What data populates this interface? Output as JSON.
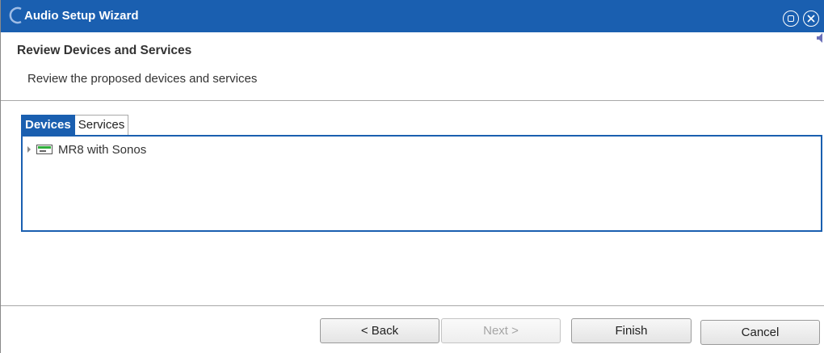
{
  "window": {
    "title": "Audio Setup Wizard",
    "accent_color": "#1a5fb0",
    "icons": [
      "app-logo-icon",
      "restore-icon",
      "close-icon",
      "speaker-icon"
    ]
  },
  "header": {
    "title": "Review Devices and Services",
    "subtitle": "Review the proposed devices and services"
  },
  "tabs": [
    {
      "label": "Devices",
      "selected": true
    },
    {
      "label": "Services",
      "selected": false
    }
  ],
  "devices_tree": [
    {
      "label": "MR8 with Sonos",
      "icon": "device-icon",
      "expanded": false
    }
  ],
  "footer": {
    "back_label": "< Back",
    "next_label": "Next >",
    "finish_label": "Finish",
    "cancel_label": "Cancel"
  }
}
